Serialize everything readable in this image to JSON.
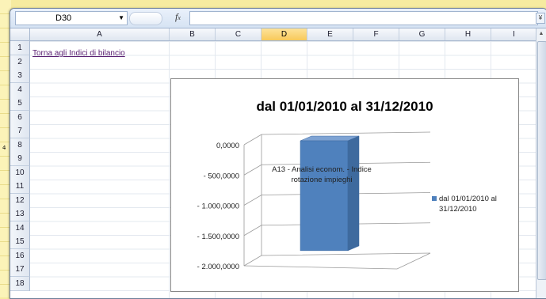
{
  "formula_bar": {
    "name_box": "D30",
    "fx": "fx",
    "formula": ""
  },
  "columns": [
    {
      "label": "A",
      "selected": false
    },
    {
      "label": "B",
      "selected": false
    },
    {
      "label": "C",
      "selected": false
    },
    {
      "label": "D",
      "selected": true
    },
    {
      "label": "E",
      "selected": false
    },
    {
      "label": "F",
      "selected": false
    },
    {
      "label": "G",
      "selected": false
    },
    {
      "label": "H",
      "selected": false
    },
    {
      "label": "I",
      "selected": false
    }
  ],
  "rows": [
    "1",
    "2",
    "3",
    "4",
    "5",
    "6",
    "7",
    "8",
    "9",
    "10",
    "11",
    "12",
    "13",
    "14",
    "15",
    "16",
    "17",
    "18"
  ],
  "cells": {
    "a1_link": "Torna agli Indici di bilancio"
  },
  "background_note": "4",
  "chart_data": {
    "type": "bar",
    "title": "dal 01/01/2010 al 31/12/2010",
    "categories": [
      "A13 - Analisi econom. - Indice rotazione impieghi"
    ],
    "series": [
      {
        "name": "dal 01/01/2010 al 31/12/2010",
        "values": [
          -1750000
        ]
      }
    ],
    "ylim": [
      -2000000,
      0
    ],
    "y_ticks": [
      "0,0000",
      "- 500,0000",
      "- 1.000,0000",
      "- 1.500,0000",
      "- 2.000,0000"
    ],
    "bar_color": "#4f81bd",
    "legend_position": "right",
    "three_d": true
  }
}
